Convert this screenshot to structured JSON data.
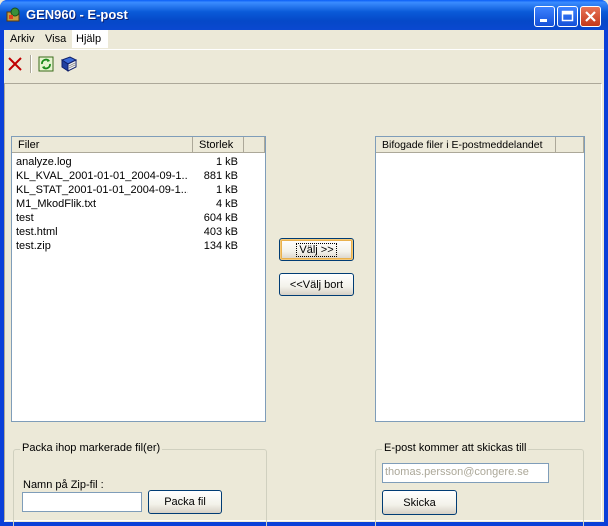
{
  "window": {
    "title": "GEN960 - E-post"
  },
  "menu": {
    "items": [
      "Arkiv",
      "Visa",
      "Hjälp"
    ]
  },
  "toolbar": {
    "icons": [
      "close-x-icon",
      "refresh-icon",
      "book-icon"
    ]
  },
  "files_panel": {
    "headers": [
      "Filer",
      "Storlek"
    ],
    "rows": [
      {
        "name": "analyze.log",
        "size": "1 kB"
      },
      {
        "name": "KL_KVAL_2001-01-01_2004-09-1...",
        "size": "881 kB"
      },
      {
        "name": "KL_STAT_2001-01-01_2004-09-1...",
        "size": "1 kB"
      },
      {
        "name": "M1_MkodFlik.txt",
        "size": "4 kB"
      },
      {
        "name": "test",
        "size": "604 kB"
      },
      {
        "name": "test.html",
        "size": "403 kB"
      },
      {
        "name": "test.zip",
        "size": "134 kB"
      }
    ]
  },
  "attached_panel": {
    "header": "Bifogade filer i E-postmeddelandet"
  },
  "buttons": {
    "select": "Välj >>",
    "deselect": "<<Välj bort",
    "pack": "Packa fil",
    "send": "Skicka"
  },
  "zip_group": {
    "title": "Packa ihop markerade fil(er)",
    "zip_label": "Namn på Zip-fil :",
    "zip_value": ""
  },
  "email_group": {
    "title": "E-post kommer att skickas till",
    "address": "thomas.persson@congere.se"
  }
}
